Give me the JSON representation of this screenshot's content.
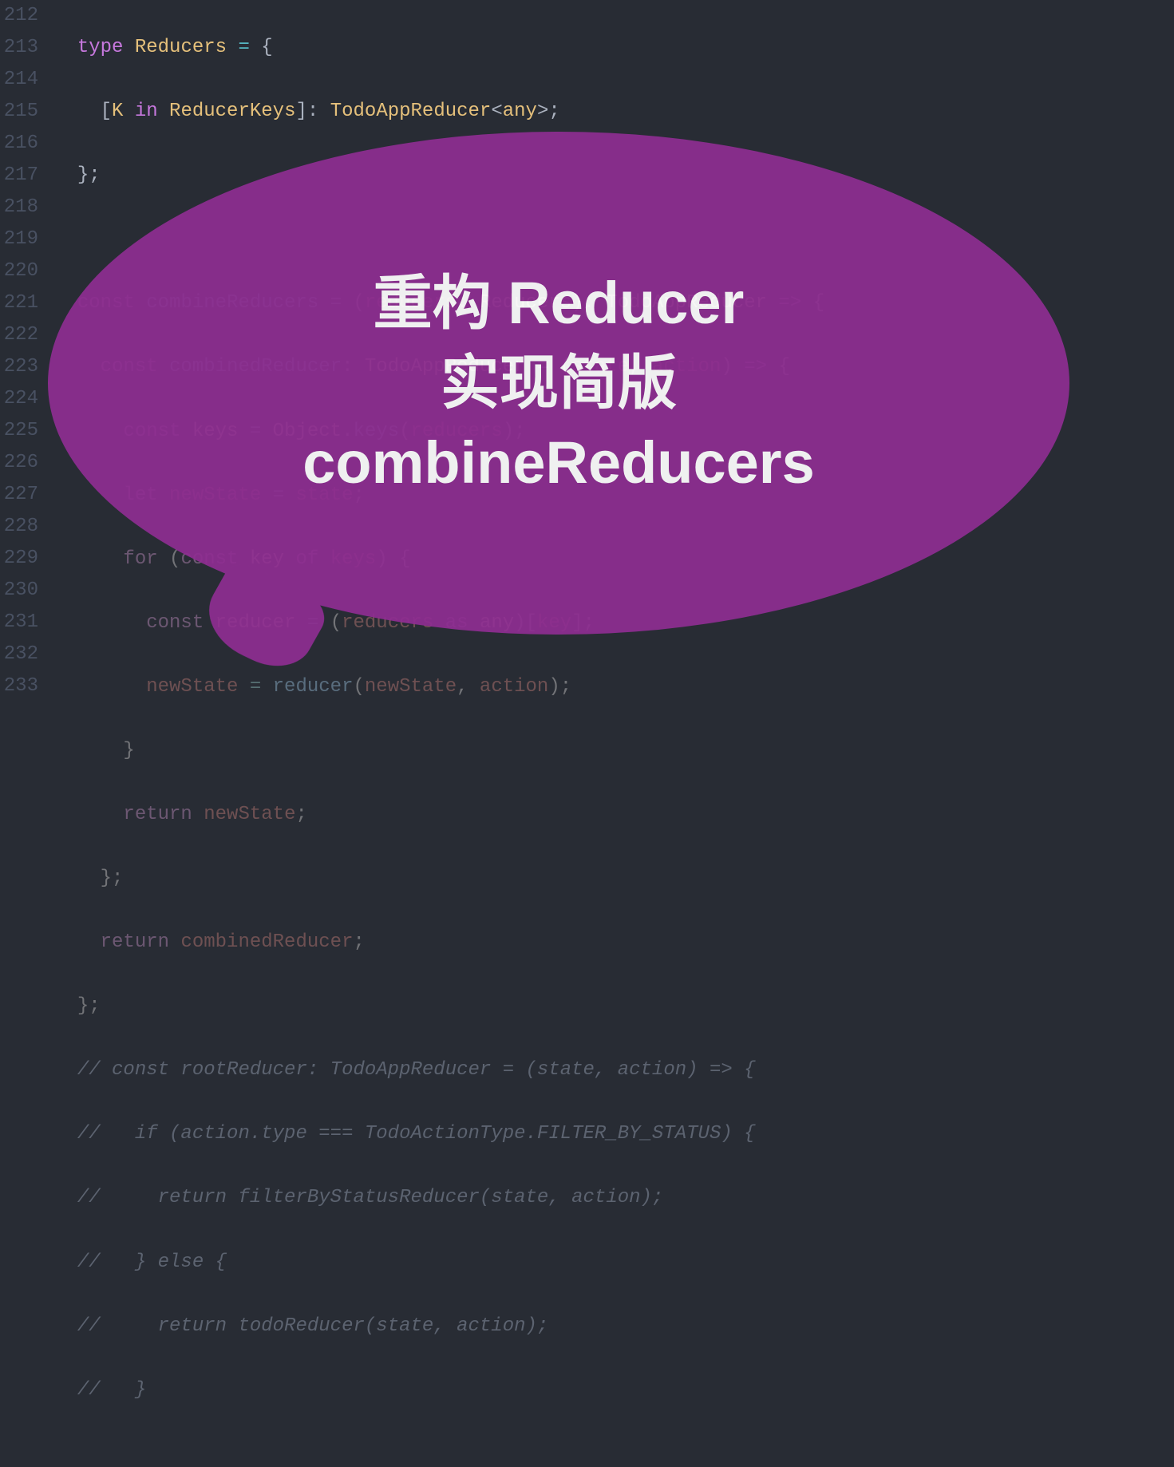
{
  "gutter": {
    "start": 212,
    "end": 233
  },
  "code": {
    "l212": {
      "t1": "type",
      "t2": "Reducers",
      "t3": "=",
      "t4": "{"
    },
    "l213": {
      "t1": "[",
      "t2": "K",
      "t3": "in",
      "t4": "ReducerKeys",
      "t5": "]:",
      "t6": "TodoAppReducer",
      "t7": "<",
      "t8": "any",
      "t9": ">;"
    },
    "l214": {
      "t1": "};"
    },
    "l216": {
      "t1": "const",
      "t2": "combineReducers",
      "t3": "=",
      "t4": "(",
      "t5": "reducers",
      "t6": ":",
      "t7": "Reducers",
      "t8": "):",
      "t9": "TodoAppReducer",
      "t10": "=>",
      "t11": "{"
    },
    "l217": {
      "t1": "const",
      "t2": "combinedReducer",
      "t3": ":",
      "t4": "TodoAppReducer",
      "t5": "=",
      "t6": "(",
      "t7": "state",
      "t8": ",",
      "t9": "action",
      "t10": ")",
      "t11": "=>",
      "t12": "{"
    },
    "l218": {
      "t1": "const",
      "t2": "keys",
      "t3": "=",
      "t4": "Object",
      "t5": ".",
      "t6": "keys",
      "t7": "(",
      "t8": "reducers",
      "t9": ");"
    },
    "l219": {
      "t1": "let",
      "t2": "newState",
      "t3": "=",
      "t4": "state",
      "t5": ";"
    },
    "l220": {
      "t1": "for",
      "t2": "(",
      "t3": "const",
      "t4": "key",
      "t5": "of",
      "t6": "keys",
      "t7": ")",
      "t8": "{"
    },
    "l221": {
      "t1": "const",
      "t2": "reducer",
      "t3": "=",
      "t4": "(",
      "t5": "reducers",
      "t6": "as",
      "t7": "any",
      "t8": ")[",
      "t9": "key",
      "t10": "];"
    },
    "l222": {
      "t1": "newState",
      "t2": "=",
      "t3": "reducer",
      "t4": "(",
      "t5": "newState",
      "t6": ",",
      "t7": "action",
      "t8": ");"
    },
    "l223": {
      "t1": "}"
    },
    "l224": {
      "t1": "return",
      "t2": "newState",
      "t3": ";"
    },
    "l225": {
      "t1": "};"
    },
    "l226": {
      "t1": "return",
      "t2": "combinedReducer",
      "t3": ";"
    },
    "l227": {
      "t1": "};"
    },
    "l228": {
      "t1": "// const rootReducer: TodoAppReducer = (state, action) => {"
    },
    "l229": {
      "t1": "//   if (action.type === TodoActionType.FILTER_BY_STATUS) {"
    },
    "l230": {
      "t1": "//     return filterByStatusReducer(state, action);"
    },
    "l231": {
      "t1": "//   } else {"
    },
    "l232": {
      "t1": "//     return todoReducer(state, action);"
    },
    "l233": {
      "t1": "//   }"
    }
  },
  "bubble": {
    "line1": "重构 Reducer",
    "line2": "实现简版",
    "line3": "combineReducers"
  }
}
